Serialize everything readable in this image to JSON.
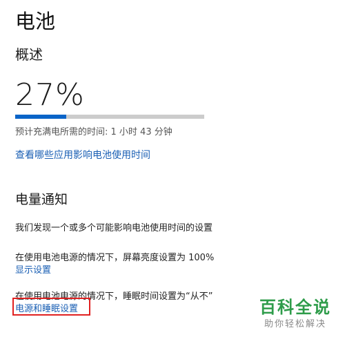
{
  "page": {
    "title": "电池"
  },
  "overview": {
    "title": "概述",
    "percent_text": "27%",
    "percent_value": 0.27,
    "charge_time_text": "预计充满电所需的时间: 1 小时 43 分钟",
    "app_usage_link": "查看哪些应用影响电池使用时间"
  },
  "notifications": {
    "title": "电量通知",
    "description": "我们发现一个或多个可能影响电池使用时间的设置",
    "brightness_text": "在使用电池电源的情况下，屏幕亮度设置为 100%",
    "display_settings_link": "显示设置",
    "sleep_text": "在使用电池电源的情况下，睡眠时间设置为“从不”",
    "power_sleep_link": "电源和睡眠设置"
  },
  "watermark": {
    "logo_text": "百科全说",
    "sub_text": "助你轻松解决"
  },
  "colors": {
    "accent": "#0a64c8",
    "link": "#1a5fb4",
    "highlight_border": "#e02020",
    "watermark_green": "#2e9c4a"
  }
}
